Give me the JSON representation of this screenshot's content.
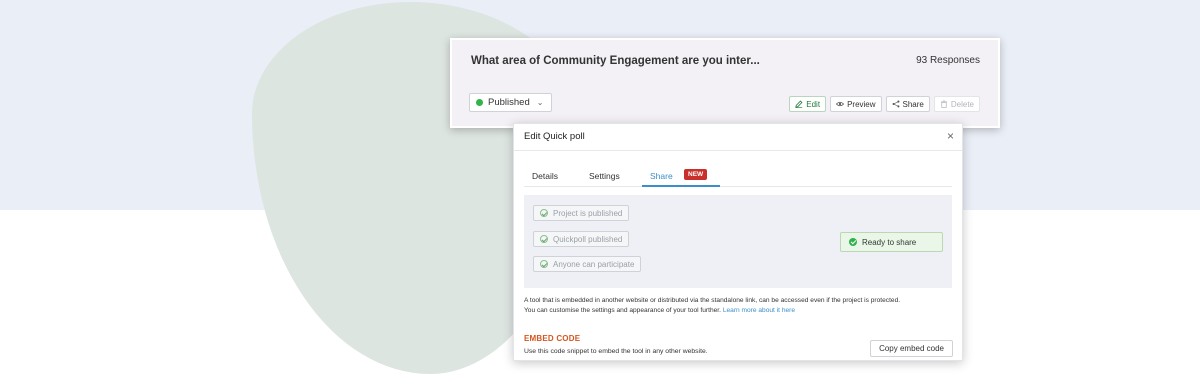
{
  "card": {
    "title": "What area of Community Engagement are you inter...",
    "responses": "93 Responses",
    "status": "Published",
    "actions": {
      "edit": "Edit",
      "preview": "Preview",
      "share": "Share",
      "delete": "Delete"
    }
  },
  "modal": {
    "title": "Edit Quick poll",
    "close": "×",
    "tabs": {
      "details": "Details",
      "settings": "Settings",
      "share": "Share",
      "new_badge": "NEW"
    },
    "checks": [
      "Project is published",
      "Quickpoll published",
      "Anyone can participate"
    ],
    "ready": "Ready to share",
    "info_line1": "A tool that is embedded in another website or distributed via the standalone link, can be accessed even if the project is protected.",
    "info_line2": "You can customise the settings and appearance of your tool further.",
    "info_link": "Learn more about it here",
    "embed_title": "EMBED CODE",
    "embed_desc": "Use this code snippet to embed the tool in any other website.",
    "copy_button": "Copy embed code"
  },
  "colors": {
    "published_dot": "#2fb34a",
    "active_tab": "#3a8fc9",
    "new_badge": "#c9302c",
    "embed_title": "#d4561e"
  },
  "icons": [
    "chevron-down-icon",
    "pencil-icon",
    "eye-icon",
    "share-icon",
    "trash-icon",
    "close-icon",
    "check-circle-icon"
  ]
}
